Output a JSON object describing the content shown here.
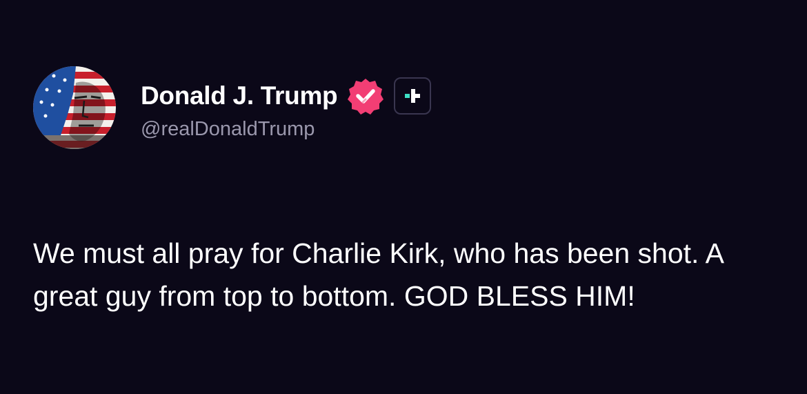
{
  "post": {
    "author": {
      "display_name": "Donald J. Trump",
      "handle": "@realDonaldTrump",
      "avatar_icon": "flag-portrait-avatar",
      "verified_icon": "verified-badge-icon",
      "verified_color": "#f23e74",
      "plus_icon": "plus-badge-icon",
      "plus_accent": "#3ee0c5"
    },
    "text": "We must all pray for Charlie Kirk, who has been shot. A great guy from top to bottom. GOD BLESS HIM!"
  },
  "colors": {
    "background": "#0b0818",
    "text": "#ffffff",
    "handle": "#9b98ad"
  }
}
